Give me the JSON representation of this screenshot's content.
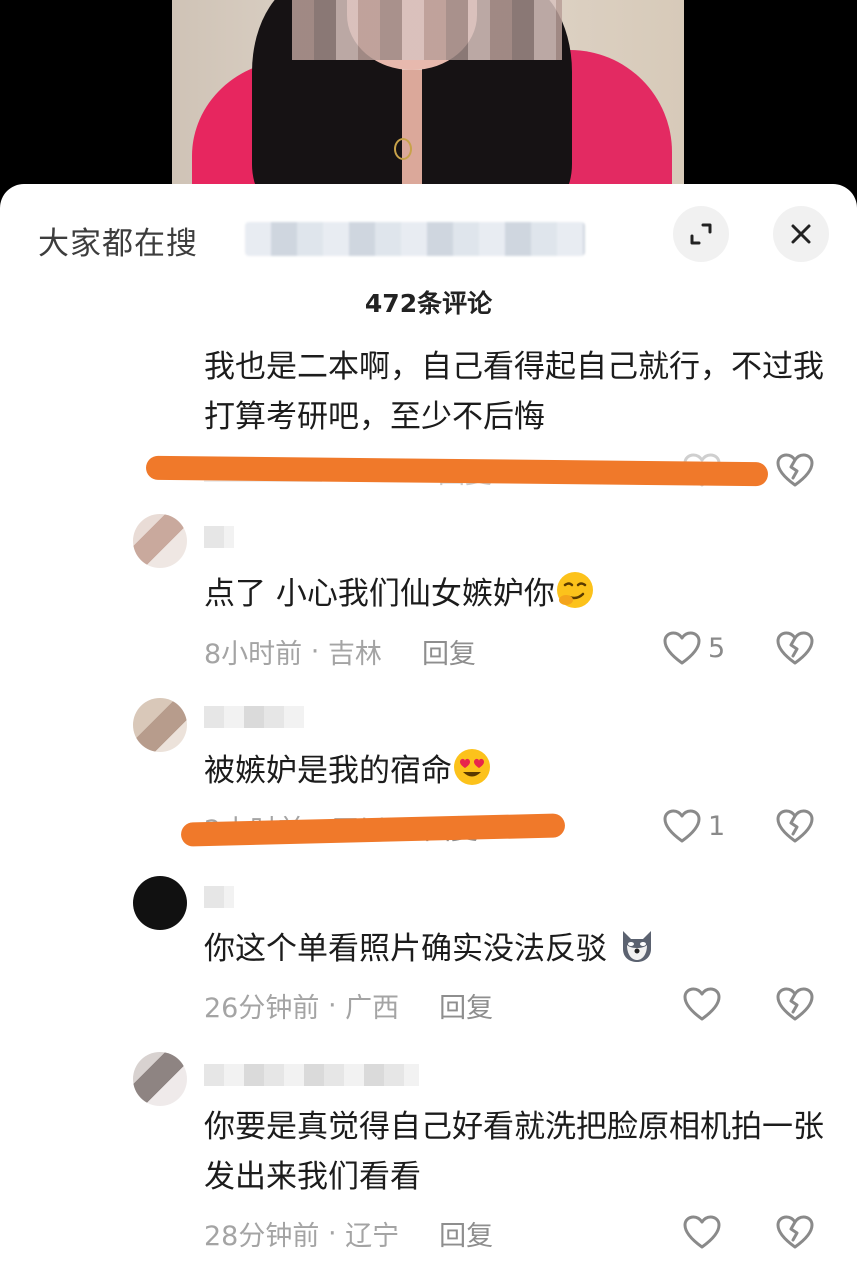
{
  "sheet": {
    "search_prefix": "大家都在搜",
    "comment_count_title": "472条评论",
    "expand_icon": "expand-icon",
    "close_icon": "close-icon"
  },
  "comments": [
    {
      "text": "我也是二本啊，自己看得起自己就行，不过我打算考研吧，至少不后悔",
      "time": "",
      "location": "",
      "reply": "回复",
      "likes": ""
    },
    {
      "text": "点了 小心我们仙女嫉妒你",
      "emoji": "smirk-emoji",
      "time": "8小时前",
      "location": "吉林",
      "reply": "回复",
      "likes": "5"
    },
    {
      "text": "被嫉妒是我的宿命",
      "emoji": "heart-eyes-emoji",
      "time": "",
      "location": "",
      "reply": "",
      "likes": "1"
    },
    {
      "text": "你这个单看照片确实没法反驳",
      "emoji": "dog-emoji",
      "time": "26分钟前",
      "location": "广西",
      "reply": "回复",
      "likes": ""
    },
    {
      "text": "你要是真觉得自己好看就洗把脸原相机拍一张发出来我们看看",
      "time": "28分钟前",
      "location": "辽宁",
      "reply": "回复",
      "likes": ""
    }
  ],
  "meta_separator": " · ",
  "colors": {
    "highlight_stroke": "#f0792a",
    "sheet_bg": "#ffffff",
    "jacket": "#e7265f"
  }
}
